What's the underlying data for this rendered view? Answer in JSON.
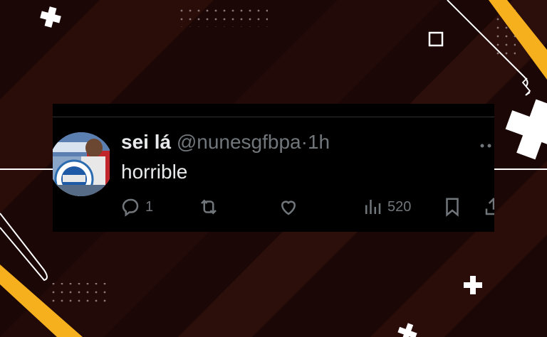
{
  "theme": {
    "background": "#1a0706",
    "accent_yellow": "#f6b01e",
    "card_background": "#000000",
    "text_primary": "#e7e9ea",
    "text_secondary": "#71767b"
  },
  "tweet": {
    "display_name": "sei lá",
    "handle": "@nunesgfbpa",
    "separator": "·",
    "timestamp": "1h",
    "text": "horrible",
    "more_icon": "more-dots-icon",
    "avatar_icon": "avatar-photo"
  },
  "actions": {
    "reply": {
      "icon": "reply-icon",
      "count": "1"
    },
    "retweet": {
      "icon": "retweet-icon"
    },
    "like": {
      "icon": "heart-icon"
    },
    "views": {
      "icon": "views-chart-icon",
      "count": "520"
    },
    "bookmark": {
      "icon": "bookmark-icon"
    },
    "share": {
      "icon": "share-icon"
    }
  }
}
